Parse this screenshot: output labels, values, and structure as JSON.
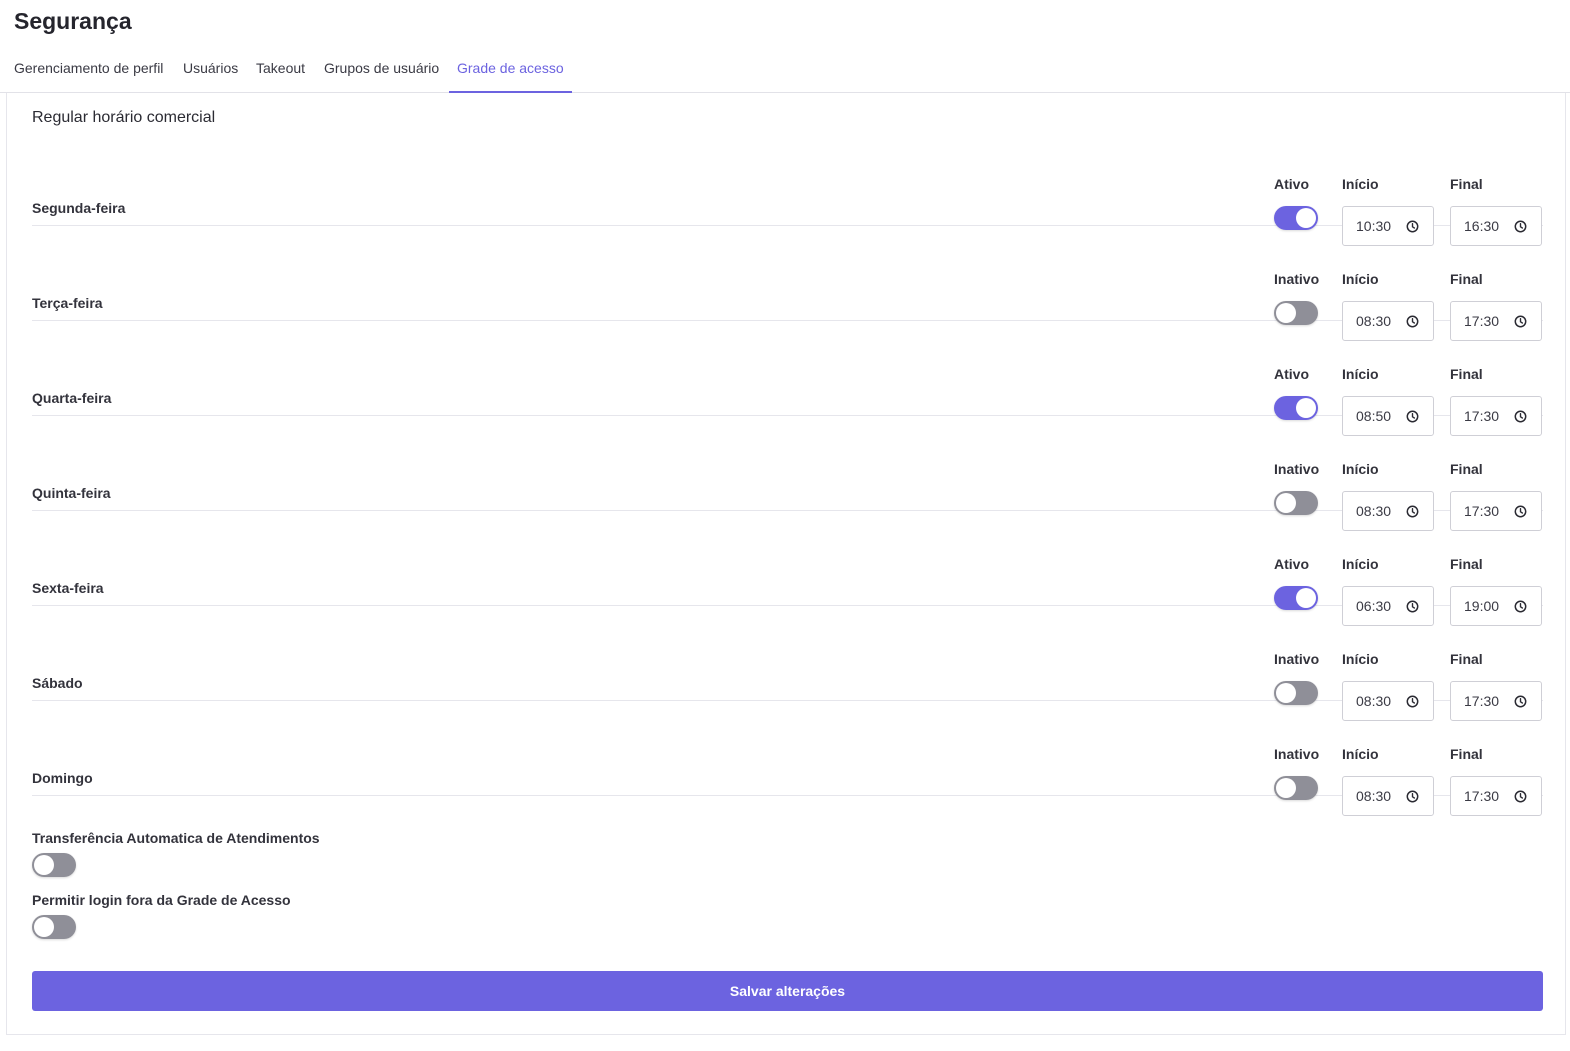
{
  "page": {
    "title": "Segurança"
  },
  "tabs": [
    {
      "label": "Gerenciamento de perfil",
      "active": false
    },
    {
      "label": "Usuários",
      "active": false
    },
    {
      "label": "Takeout",
      "active": false
    },
    {
      "label": "Grupos de usuário",
      "active": false
    },
    {
      "label": "Grade de acesso",
      "active": true
    }
  ],
  "section": {
    "title": "Regular horário comercial"
  },
  "columns": {
    "start_label": "Início",
    "end_label": "Final"
  },
  "days": [
    {
      "name": "Segunda-feira",
      "active": true,
      "status_label": "Ativo",
      "start": "10:30",
      "end": "16:30"
    },
    {
      "name": "Terça-feira",
      "active": false,
      "status_label": "Inativo",
      "start": "08:30",
      "end": "17:30"
    },
    {
      "name": "Quarta-feira",
      "active": true,
      "status_label": "Ativo",
      "start": "08:50",
      "end": "17:30"
    },
    {
      "name": "Quinta-feira",
      "active": false,
      "status_label": "Inativo",
      "start": "08:30",
      "end": "17:30"
    },
    {
      "name": "Sexta-feira",
      "active": true,
      "status_label": "Ativo",
      "start": "06:30",
      "end": "19:00"
    },
    {
      "name": "Sábado",
      "active": false,
      "status_label": "Inativo",
      "start": "08:30",
      "end": "17:30"
    },
    {
      "name": "Domingo",
      "active": false,
      "status_label": "Inativo",
      "start": "08:30",
      "end": "17:30"
    }
  ],
  "options": {
    "auto_transfer": {
      "label": "Transferência Automatica de Atendimentos",
      "enabled": false
    },
    "login_outside": {
      "label": "Permitir login fora da Grade de Acesso",
      "enabled": false
    }
  },
  "save_button": {
    "label": "Salvar alterações"
  },
  "colors": {
    "accent": "#6c63e0",
    "toggle_off": "#8f8f98"
  },
  "icons": {
    "time": "clock-icon"
  }
}
